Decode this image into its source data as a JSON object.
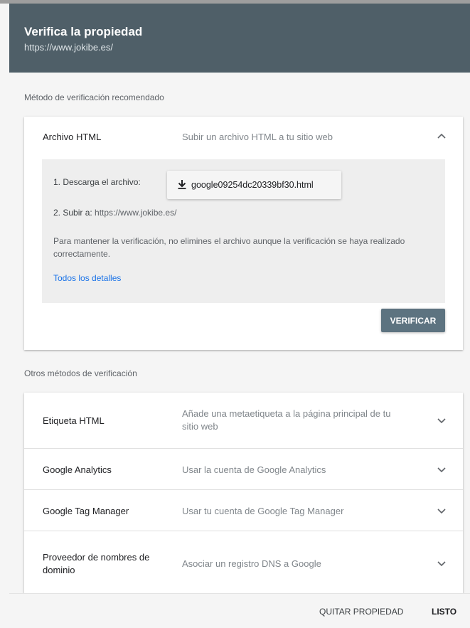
{
  "header": {
    "title": "Verifica la propiedad",
    "url": "https://www.jokibe.es/"
  },
  "recommended": {
    "section_label": "Método de verificación recomendado",
    "method": {
      "name": "Archivo HTML",
      "description": "Subir un archivo HTML a tu sitio web",
      "expanded": true,
      "step1_label": "1. Descarga el archivo:",
      "download_file": "google09254dc20339bf30.html",
      "step2_prefix": "2. Subir a: ",
      "step2_url": "https://www.jokibe.es/",
      "note": "Para mantener la verificación, no elimines el archivo aunque la verificación se haya realizado correctamente.",
      "details_link": "Todos los detalles",
      "verify_button": "VERIFICAR"
    }
  },
  "others": {
    "section_label": "Otros métodos de verificación",
    "methods": [
      {
        "name": "Etiqueta HTML",
        "description": "Añade una metaetiqueta a la página principal de tu sitio web"
      },
      {
        "name": "Google Analytics",
        "description": "Usar la cuenta de Google Analytics"
      },
      {
        "name": "Google Tag Manager",
        "description": "Usar tu cuenta de Google Tag Manager"
      },
      {
        "name": "Proveedor de nombres de dominio",
        "description": "Asociar un registro DNS a Google"
      }
    ]
  },
  "footer": {
    "remove_label": "QUITAR PROPIEDAD",
    "done_label": "LISTO"
  },
  "icons": {
    "download": "download-icon",
    "expand": "chevron-down-icon",
    "collapse": "chevron-up-icon"
  },
  "colors": {
    "header_bg": "#4f5f68",
    "verify_bg": "#5d7380",
    "link": "#1a73e8"
  }
}
